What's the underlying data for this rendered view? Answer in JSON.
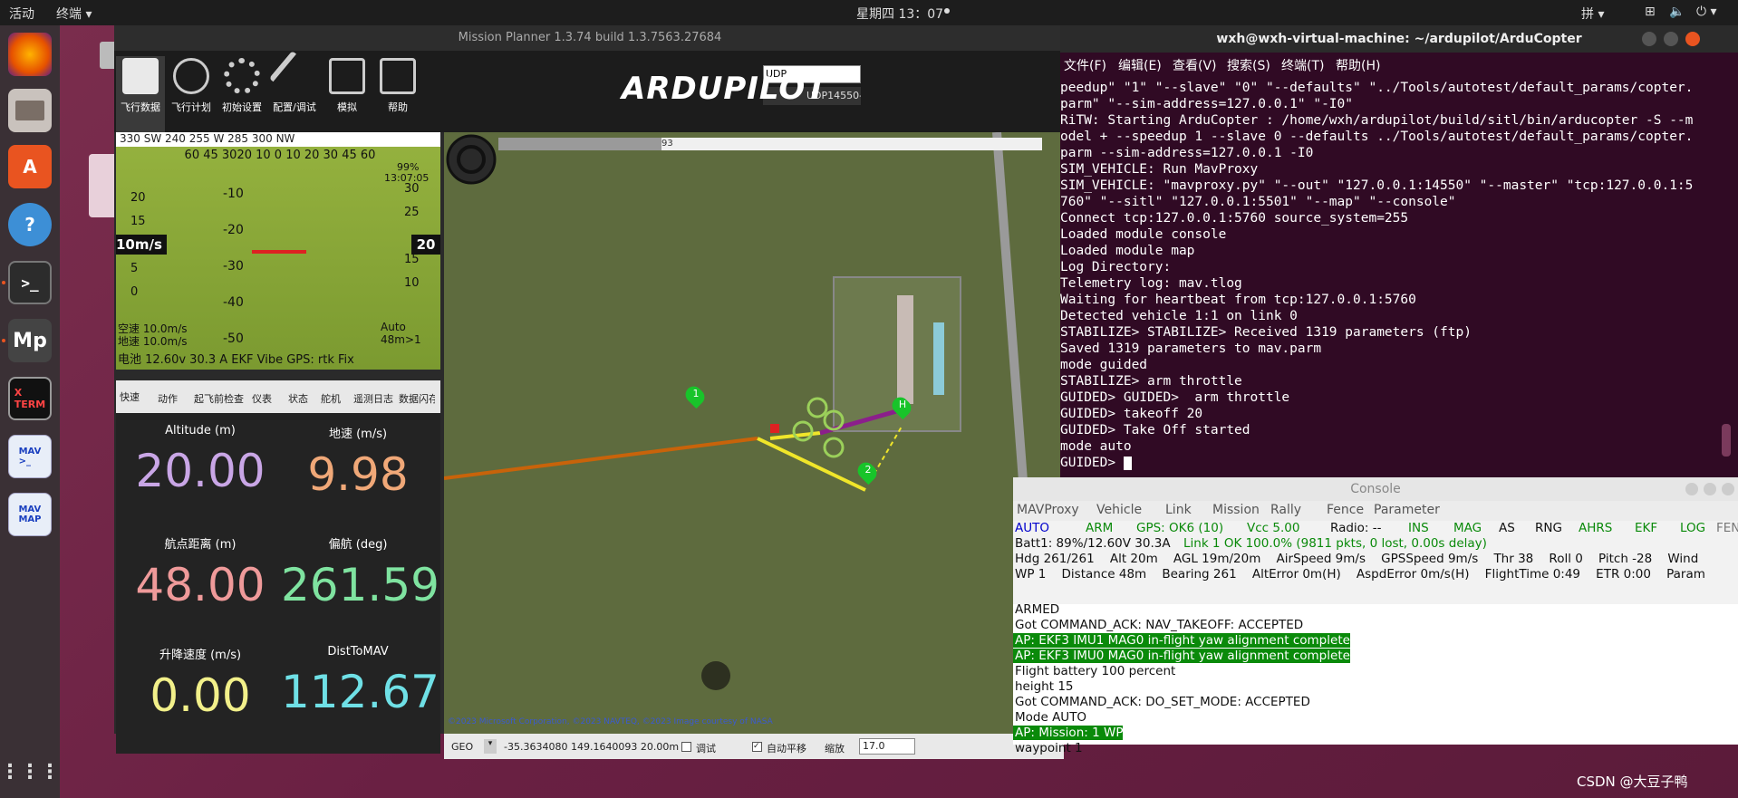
{
  "topbar": {
    "activities": "活动",
    "terminal_menu": "终端 ▾",
    "clock": "星期四 13：07",
    "input_method": "拼 ▾"
  },
  "mp": {
    "title": "Mission Planner 1.3.74 build 1.3.7563.27684",
    "toolbar": [
      {
        "label": "飞行数据",
        "icon": "flight-data-icon"
      },
      {
        "label": "飞行计划",
        "icon": "flight-plan-icon"
      },
      {
        "label": "初始设置",
        "icon": "setup-icon"
      },
      {
        "label": "配置/调试",
        "icon": "config-icon"
      },
      {
        "label": "模拟",
        "icon": "simulation-icon"
      },
      {
        "label": "帮助",
        "icon": "help-icon"
      }
    ],
    "logo": "ARDUPILOT",
    "connection_type": "UDP",
    "connection_port": "UDP14550-1-",
    "hud": {
      "heading_tape": "330  SW  240  255  W  285  300  NW",
      "pitch_labels": [
        "-10",
        "-20",
        "-30",
        "-40",
        "-50"
      ],
      "roll_labels": "60 45 3020 10 0 10 20 30 45 60",
      "left_tape": [
        "20",
        "15",
        "10",
        "5",
        "0"
      ],
      "right_tape": [
        "30",
        "25",
        "15",
        "10"
      ],
      "speed_box": "10m/s",
      "alt_box": "20",
      "battery_pct": "99%",
      "time": "13:07:05",
      "airspeed": "空速 10.0m/s",
      "groundspeed": "地速 10.0m/s",
      "mode": "Auto",
      "wp": "48m>1",
      "status_line": "电池 12.60v 30.3 A EKF Vibe GPS: rtk Fix"
    },
    "quick_tabs": [
      "快速",
      "动作",
      "起飞前检查",
      "仪表",
      "状态",
      "舵机",
      "遥测日志",
      "数据闪存"
    ],
    "quick": [
      {
        "label": "Altitude (m)",
        "value": "20.00",
        "color": "#c9a6e6"
      },
      {
        "label": "地速 (m/s)",
        "value": "9.98",
        "color": "#f0a878"
      },
      {
        "label": "航点距离 (m)",
        "value": "48.00",
        "color": "#ef9a9a"
      },
      {
        "label": "偏航 (deg)",
        "value": "261.59",
        "color": "#7fe3a0"
      },
      {
        "label": "升降速度 (m/s)",
        "value": "0.00",
        "color": "#f2f08a"
      },
      {
        "label": "DistToMAV",
        "value": "112.67",
        "color": "#6fe0e6"
      }
    ],
    "map": {
      "progress_value": "93",
      "copyright": "©2023 Microsoft Corporation, ©2023 NAVTEQ, ©2023 Image courtesy of NASA",
      "markers": [
        "1",
        "2",
        "H"
      ]
    },
    "map_bar": {
      "mode": "GEO",
      "coords": "-35.3634080 149.1640093   20.00m",
      "debug": "调试",
      "autopan": "自动平移",
      "zoom_label": "缩放",
      "zoom_value": "17.0"
    }
  },
  "terminal": {
    "title": "wxh@wxh-virtual-machine: ~/ardupilot/ArduCopter",
    "menu": [
      "文件(F)",
      "编辑(E)",
      "查看(V)",
      "搜索(S)",
      "终端(T)",
      "帮助(H)"
    ],
    "lines": [
      "peedup\" \"1\" \"--slave\" \"0\" \"--defaults\" \"../Tools/autotest/default_params/copter.",
      "parm\" \"--sim-address=127.0.0.1\" \"-I0\"",
      "RiTW: Starting ArduCopter : /home/wxh/ardupilot/build/sitl/bin/arducopter -S --m",
      "odel + --speedup 1 --slave 0 --defaults ../Tools/autotest/default_params/copter.",
      "parm --sim-address=127.0.0.1 -I0",
      "SIM_VEHICLE: Run MavProxy",
      "SIM_VEHICLE: \"mavproxy.py\" \"--out\" \"127.0.0.1:14550\" \"--master\" \"tcp:127.0.0.1:5",
      "760\" \"--sitl\" \"127.0.0.1:5501\" \"--map\" \"--console\"",
      "Connect tcp:127.0.0.1:5760 source_system=255",
      "Loaded module console",
      "Loaded module map",
      "Log Directory:",
      "Telemetry log: mav.tlog",
      "Waiting for heartbeat from tcp:127.0.0.1:5760",
      "Detected vehicle 1:1 on link 0",
      "STABILIZE> STABILIZE> Received 1319 parameters (ftp)",
      "Saved 1319 parameters to mav.parm",
      "mode guided",
      "STABILIZE> arm throttle",
      "GUIDED> GUIDED>  arm throttle",
      "GUIDED> takeoff 20",
      "GUIDED> Take Off started",
      "mode auto",
      "GUIDED> "
    ]
  },
  "console": {
    "title": "Console",
    "menu": [
      "MAVProxy",
      "Vehicle",
      "Link",
      "Mission",
      "Rally",
      "Fence",
      "Parameter"
    ],
    "row1": [
      {
        "t": "AUTO",
        "c": "#0000cc"
      },
      {
        "t": "ARM",
        "c": "#0a8a0a"
      },
      {
        "t": "GPS: OK6 (10)",
        "c": "#0a8a0a"
      },
      {
        "t": "Vcc 5.00",
        "c": "#0a8a0a"
      },
      {
        "t": "Radio: --",
        "c": "#111"
      },
      {
        "t": "INS",
        "c": "#0a8a0a"
      },
      {
        "t": "MAG",
        "c": "#0a8a0a"
      },
      {
        "t": "AS",
        "c": "#111"
      },
      {
        "t": "RNG",
        "c": "#111"
      },
      {
        "t": "AHRS",
        "c": "#0a8a0a"
      },
      {
        "t": "EKF",
        "c": "#0a8a0a"
      },
      {
        "t": "LOG",
        "c": "#0a8a0a"
      },
      {
        "t": "FEN",
        "c": "#777"
      }
    ],
    "row2": "Batt1: 89%/12.60V 30.3A",
    "row2b": "Link 1 OK 100.0% (9811 pkts, 0 lost, 0.00s delay)",
    "row3": "Hdg 261/261    Alt 20m    AGL 19m/20m    AirSpeed 9m/s    GPSSpeed 9m/s    Thr 38    Roll 0    Pitch -28    Wind",
    "row4": "WP 1    Distance 48m    Bearing 261    AltError 0m(H)    AspdError 0m/s(H)    FlightTime 0:49    ETR 0:00    Param",
    "log": [
      {
        "t": "ARMED",
        "hl": false
      },
      {
        "t": "Got COMMAND_ACK: NAV_TAKEOFF: ACCEPTED",
        "hl": false
      },
      {
        "t": "AP: EKF3 IMU1 MAG0 in-flight yaw alignment complete",
        "hl": true
      },
      {
        "t": "AP: EKF3 IMU0 MAG0 in-flight yaw alignment complete",
        "hl": true
      },
      {
        "t": "Flight battery 100 percent",
        "hl": false
      },
      {
        "t": "height 15",
        "hl": false
      },
      {
        "t": "Got COMMAND_ACK: DO_SET_MODE: ACCEPTED",
        "hl": false
      },
      {
        "t": "Mode AUTO",
        "hl": false
      },
      {
        "t": "AP: Mission: 1 WP",
        "hl": true
      },
      {
        "t": "waypoint 1",
        "hl": false
      }
    ]
  },
  "watermark": "CSDN @大豆子鸭"
}
